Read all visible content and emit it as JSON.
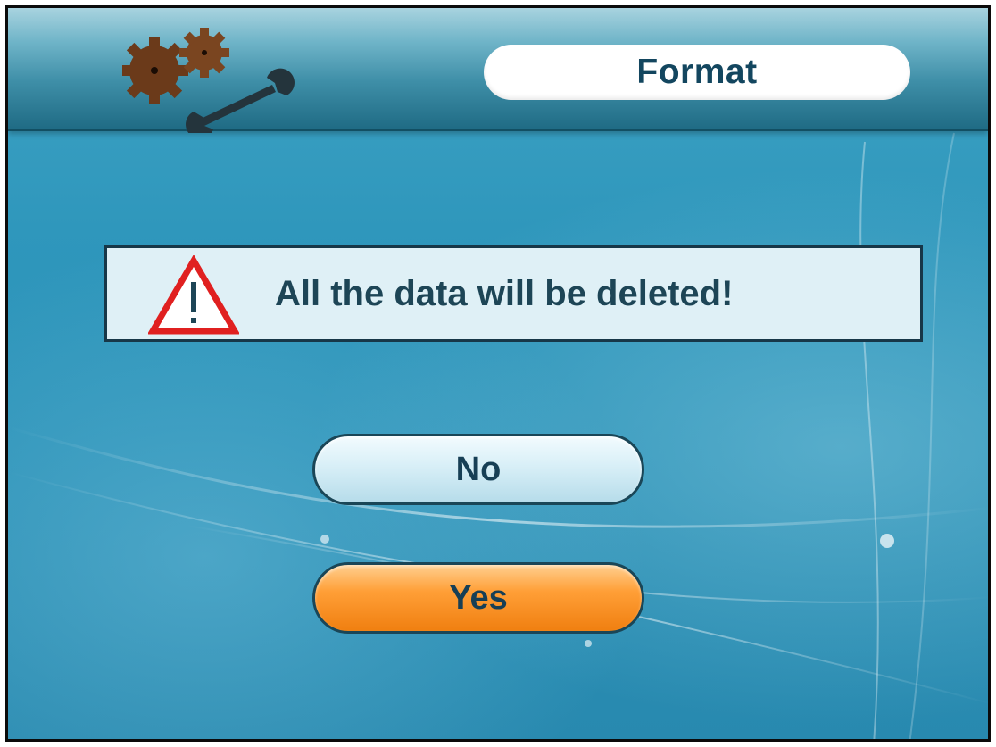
{
  "header": {
    "title": "Format",
    "logo_icon": "gears-wrench-icon"
  },
  "dialog": {
    "warning_icon": "warning-triangle-icon",
    "message": "All the data will be deleted!"
  },
  "buttons": {
    "no_label": "No",
    "yes_label": "Yes",
    "selected": "Yes"
  },
  "colors": {
    "background": "#2f97bc",
    "header": "#3f8fa8",
    "title_text": "#13465f",
    "warning_red": "#e02020",
    "no_button": "#d8eff7",
    "yes_button": "#ff9f37"
  }
}
